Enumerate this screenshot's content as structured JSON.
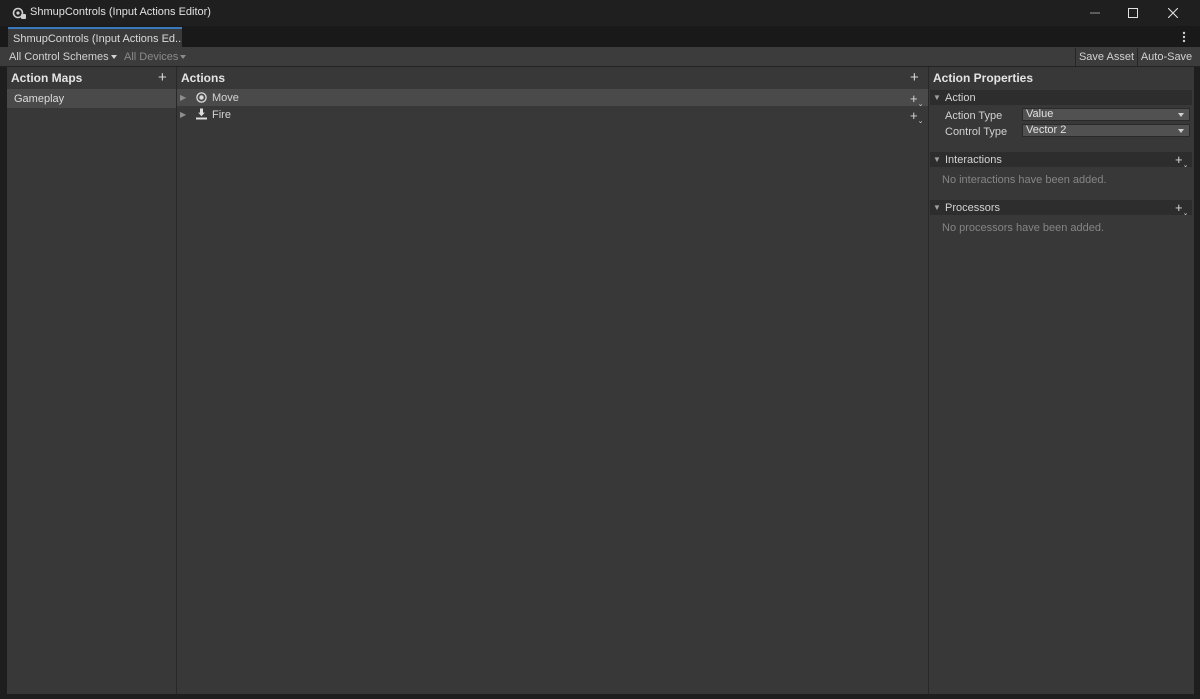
{
  "window": {
    "title": "ShmupControls (Input Actions Editor)"
  },
  "tab": {
    "label": "ShmupControls (Input Actions Ed..."
  },
  "toolbar": {
    "control_schemes": "All Control Schemes",
    "devices": "All Devices",
    "save_asset": "Save Asset",
    "auto_save": "Auto-Save"
  },
  "action_maps": {
    "title": "Action Maps",
    "items": [
      {
        "label": "Gameplay",
        "selected": true
      }
    ]
  },
  "actions": {
    "title": "Actions",
    "items": [
      {
        "label": "Move",
        "icon": "value-action-icon",
        "selected": true
      },
      {
        "label": "Fire",
        "icon": "button-action-icon",
        "selected": false
      }
    ]
  },
  "properties": {
    "title": "Action Properties",
    "action_section": "Action",
    "action_type_label": "Action Type",
    "action_type_value": "Value",
    "control_type_label": "Control Type",
    "control_type_value": "Vector 2",
    "interactions_section": "Interactions",
    "interactions_empty": "No interactions have been added.",
    "processors_section": "Processors",
    "processors_empty": "No processors have been added."
  },
  "colors": {
    "tab_accent": "#3a79bb",
    "panel_bg": "#383838",
    "selected_row": "#4a4a4a"
  }
}
